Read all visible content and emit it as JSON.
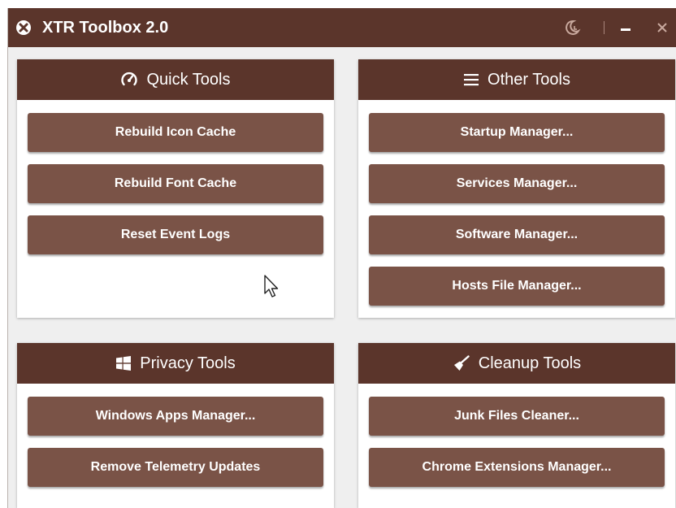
{
  "app": {
    "title": "XTR Toolbox 2.0",
    "colors": {
      "titlebar": "#5b352b",
      "panel_header": "#5b352b",
      "button": "#7a5347",
      "window_bg": "#efefef",
      "text": "#ffffff"
    }
  },
  "titlebar": {
    "app_icon": "crossed-circle-icon",
    "theme_icon": "moon-clock-icon",
    "minimize_icon": "minimize-icon",
    "close_icon": "close-icon"
  },
  "panels": {
    "quick": {
      "title": "Quick Tools",
      "icon": "speedometer-icon",
      "buttons": [
        "Rebuild Icon Cache",
        "Rebuild Font Cache",
        "Reset Event Logs"
      ]
    },
    "other": {
      "title": "Other Tools",
      "icon": "hamburger-menu-icon",
      "buttons": [
        "Startup Manager...",
        "Services Manager...",
        "Software Manager...",
        "Hosts File Manager..."
      ]
    },
    "privacy": {
      "title": "Privacy Tools",
      "icon": "windows-logo-icon",
      "buttons": [
        "Windows Apps Manager...",
        "Remove Telemetry Updates"
      ]
    },
    "cleanup": {
      "title": "Cleanup Tools",
      "icon": "broom-icon",
      "buttons": [
        "Junk Files Cleaner...",
        "Chrome Extensions Manager..."
      ]
    }
  }
}
